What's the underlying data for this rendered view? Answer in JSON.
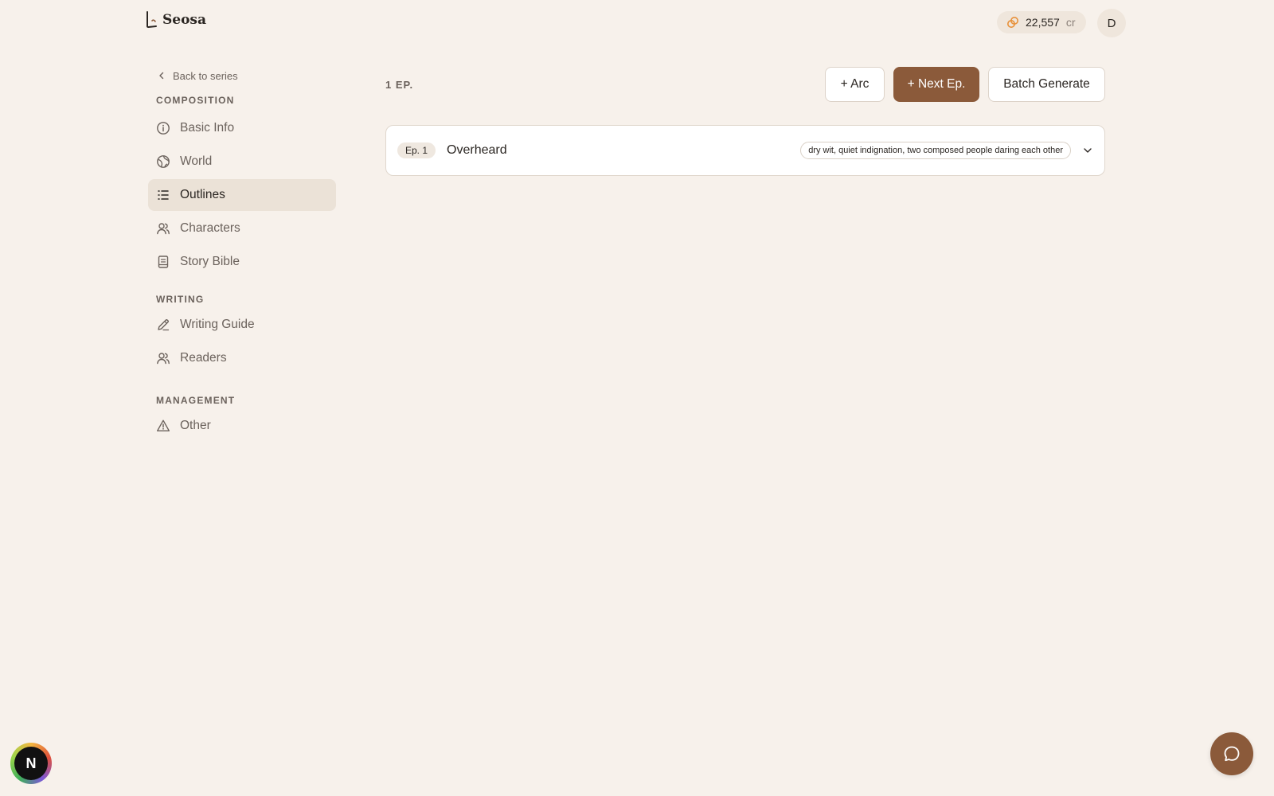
{
  "header": {
    "brand": "Seosa",
    "credits": {
      "amount": "22,557",
      "unit": "cr",
      "icon": "coins-icon"
    },
    "avatar_initial": "D"
  },
  "sidebar": {
    "back_label": "Back to series",
    "sections": {
      "composition": {
        "title": "COMPOSITION",
        "items": [
          {
            "label": "Basic Info",
            "icon": "info-icon"
          },
          {
            "label": "World",
            "icon": "globe-icon"
          },
          {
            "label": "Outlines",
            "icon": "list-icon",
            "active": true
          },
          {
            "label": "Characters",
            "icon": "users-icon"
          },
          {
            "label": "Story Bible",
            "icon": "book-icon"
          }
        ]
      },
      "writing": {
        "title": "WRITING",
        "items": [
          {
            "label": "Writing Guide",
            "icon": "pen-icon"
          },
          {
            "label": "Readers",
            "icon": "readers-icon"
          }
        ]
      },
      "management": {
        "title": "MANAGEMENT",
        "items": [
          {
            "label": "Other",
            "icon": "warning-icon"
          }
        ]
      }
    }
  },
  "main": {
    "episode_count": "1 EP.",
    "buttons": {
      "add_arc": "+ Arc",
      "next_ep": "+ Next Ep.",
      "batch_generate": "Batch Generate"
    },
    "episodes": [
      {
        "badge": "Ep. 1",
        "title": "Overheard",
        "tone": "dry wit, quiet indignation, two composed people daring each other"
      }
    ]
  },
  "floating": {
    "chat_icon": "chat-icon",
    "n_badge": "N"
  },
  "colors": {
    "background": "#f7f1eb",
    "accent": "#8b5a3a",
    "active_item": "#ebe2d7",
    "credit_icon": "#e8913a"
  }
}
